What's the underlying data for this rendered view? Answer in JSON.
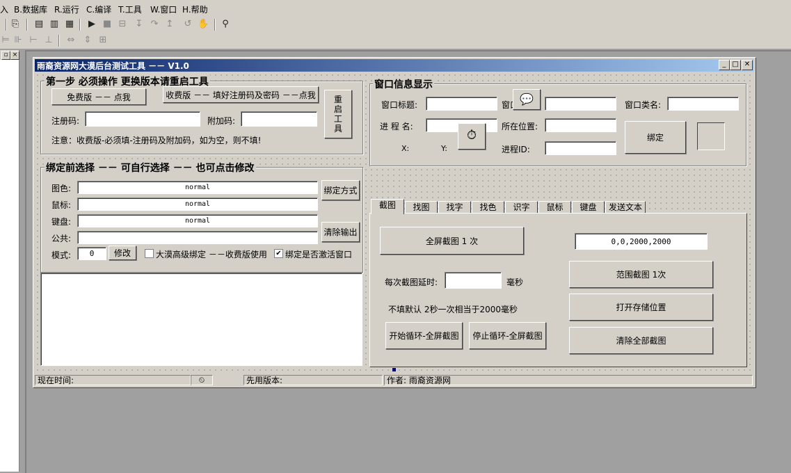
{
  "menu": [
    "入",
    "B.数据库",
    "R.运行",
    "C.编译",
    "T.工具",
    "W.窗口",
    "H.帮助"
  ],
  "form": {
    "title": "雨裔资源网大漠后台测试工具 －－ V1.0",
    "min": "_",
    "max": "□",
    "close": "✕"
  },
  "step1": {
    "title": "第一步  必须操作   更换版本请重启工具",
    "free_btn": "免费版 －－ 点我",
    "paid_btn": "收费版 －－ 填好注册码及密码 －－点我",
    "restart_btn": "重启工具",
    "reg_label": "注册码:",
    "reg_value": "",
    "extra_label": "附加码:",
    "extra_value": "",
    "note": "注意：收费版-必须填-注册码及附加码，如为空，则不填!"
  },
  "bind": {
    "title": "绑定前选择 －－ 可自行选择 －－ 也可点击修改",
    "display_label": "图色:",
    "display_value": "normal",
    "mouse_label": "鼠标:",
    "mouse_value": "normal",
    "keypad_label": "键盘:",
    "keypad_value": "normal",
    "public_label": "公共:",
    "public_value": "",
    "mode_label": "模式:",
    "mode_value": "0",
    "modify_btn": "修改",
    "bind_method_btn": "绑定方式",
    "clear_output_btn": "清除输出",
    "advanced_label": "大漠高级绑定 －－收费版使用",
    "advanced_checked": "",
    "activate_label": "绑定是否激活窗口",
    "activate_checked": "✔"
  },
  "window_info": {
    "title": "窗口信息显示",
    "win_title_label": "窗口标题:",
    "handle_label": "窗口",
    "class_label": "窗口类名:",
    "process_label": "进  程  名:",
    "location_label": "所在位置:",
    "pid_label": "进程ID:",
    "x_label": "X:",
    "y_label": "Y:",
    "bind_btn": "绑定"
  },
  "tabs": [
    "截图",
    "找图",
    "找字",
    "找色",
    "识字",
    "鼠标",
    "键盘",
    "发送文本"
  ],
  "screenshot": {
    "fullscreen_btn": "全屏截图 1 次",
    "range_value": "0,0,2000,2000",
    "range_btn": "范围截图 1次",
    "delay_label": "每次截图延时:",
    "delay_value": "",
    "ms_label": "毫秒",
    "open_storage_btn": "打开存储位置",
    "default_note": "不填默认 2秒一次相当于2000毫秒",
    "start_loop_btn": "开始循环-全屏截图",
    "stop_loop_btn": "停止循环-全屏截图",
    "clear_all_btn": "清除全部截图"
  },
  "status": {
    "time": "现在时间:",
    "version": "先用版本:",
    "author": "作者: 雨裔资源网"
  }
}
